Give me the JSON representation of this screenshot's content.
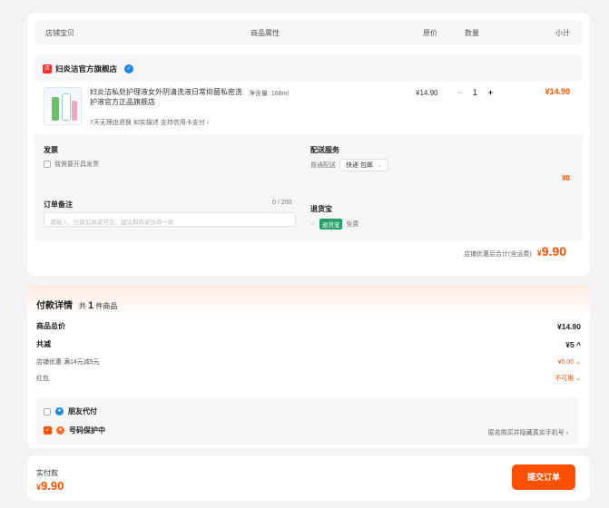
{
  "header": {
    "col_shop": "店铺宝贝",
    "col_attr": "商品属性",
    "col_price": "原价",
    "col_qty": "数量",
    "col_subtotal": "小计"
  },
  "shop": {
    "name": "妇炎洁官方旗舰店",
    "product": {
      "title": "妇炎洁私处护理液女外阴清洗液日常抑菌私密洗护液官方正品旗舰店",
      "tags": "7天无理由退换   如实描述   支持信用卡支付 ›",
      "spec": "净含量: 168ml",
      "price": "¥14.90",
      "quantity": "1",
      "subtotal": "¥14.90"
    }
  },
  "invoice": {
    "label": "发票",
    "option": "我需要开具发票"
  },
  "memo": {
    "label": "订单备注",
    "count": "0 / 200",
    "placeholder": "请输入，付款后商家可见，建议和商家协商一致"
  },
  "shipping": {
    "label": "配送服务",
    "type": "普通配送",
    "selected": "快递 包邮",
    "fee": "¥0"
  },
  "return_insurance": {
    "label": "退货宝",
    "badge": "退货宝",
    "status": "免费"
  },
  "shop_total": {
    "label": "店铺优惠后合计(含运费)",
    "currency": "¥",
    "amount": "9.90"
  },
  "payment": {
    "title": "付款详情",
    "count_prefix": "共",
    "count": "1",
    "count_suffix": "件商品",
    "goods_total_label": "商品总价",
    "goods_total": "¥14.90",
    "discount_label": "共减",
    "discount": "¥5 ^",
    "shop_discount_label": "店铺优惠  满14元减5元",
    "shop_discount": "¥5.00 ⌄",
    "redpacket_label": "红包",
    "redpacket": "不可用 ⌄"
  },
  "extras": {
    "friend_pay": "朋友代付",
    "number_protect": "号码保护中",
    "number_note": "匿名购买并隐藏真实手机号 ›"
  },
  "footer": {
    "actual_label": "实付款",
    "currency": "¥",
    "amount": "9.90",
    "submit": "提交订单"
  },
  "colors": {
    "accent": "#ff5000",
    "green": "#26a269"
  }
}
